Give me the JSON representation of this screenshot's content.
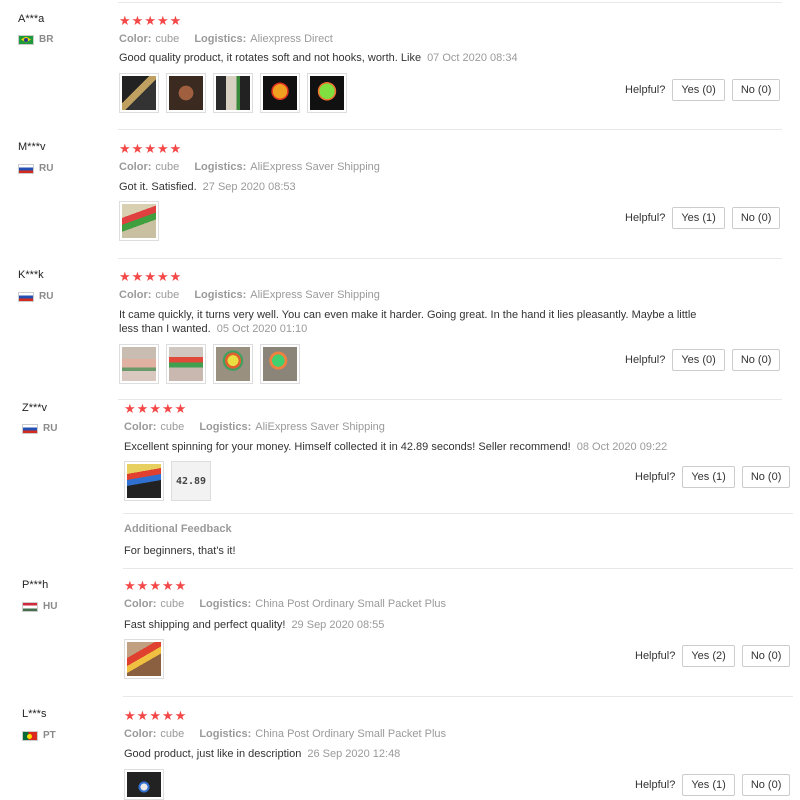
{
  "ui": {
    "helpful_label": "Helpful?",
    "color_key": "Color:",
    "logistics_key": "Logistics:"
  },
  "reviews": [
    {
      "user": "A***a",
      "country": "BR",
      "color": "cube",
      "logistics": "Aliexpress Direct",
      "text": "Good quality product, it rotates soft and not hooks, worth. Like",
      "date": "07 Oct 2020 08:34",
      "yes": "Yes (0)",
      "no": "No (0)"
    },
    {
      "user": "M***v",
      "country": "RU",
      "color": "cube",
      "logistics": "AliExpress Saver Shipping",
      "text": "Got it. Satisfied.",
      "date": "27 Sep 2020 08:53",
      "yes": "Yes (1)",
      "no": "No (0)"
    },
    {
      "user": "K***k",
      "country": "RU",
      "color": "cube",
      "logistics": "AliExpress Saver Shipping",
      "text_line1": "It came quickly, it turns very well. You can even make it harder. Going great. In the hand it lies pleasantly. Maybe a little",
      "text_line2": "less than I wanted.",
      "date": "05 Oct 2020 01:10",
      "yes": "Yes (0)",
      "no": "No (0)"
    },
    {
      "user": "Z***v",
      "country": "RU",
      "color": "cube",
      "logistics": "AliExpress Saver Shipping",
      "text": "Excellent spinning for your money. Himself collected it in 42.89 seconds! Seller recommend!",
      "date": "08 Oct 2020 09:22",
      "thumb_text": "42.89",
      "yes": "Yes (1)",
      "no": "No (0)",
      "additional_title": "Additional Feedback",
      "additional_text": "For beginners, that's it!"
    },
    {
      "user": "P***h",
      "country": "HU",
      "color": "cube",
      "logistics": "China Post Ordinary Small Packet Plus",
      "text": "Fast shipping and perfect quality!",
      "date": "29 Sep 2020 08:55",
      "yes": "Yes (2)",
      "no": "No (0)"
    },
    {
      "user": "L***s",
      "country": "PT",
      "color": "cube",
      "logistics": "China Post Ordinary Small Packet Plus",
      "text": "Good product, just like in description",
      "date": "26 Sep 2020 12:48",
      "yes": "Yes (1)",
      "no": "No (0)"
    }
  ]
}
